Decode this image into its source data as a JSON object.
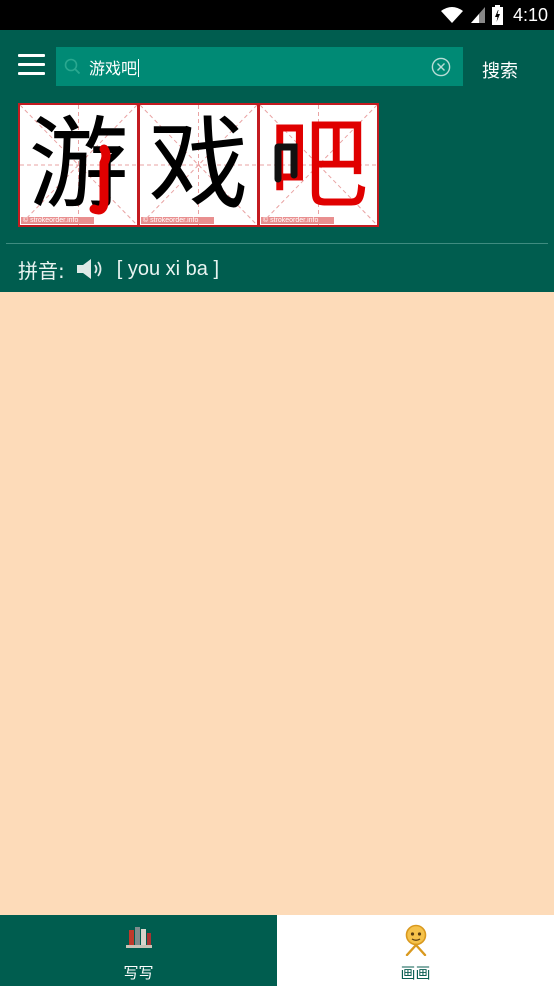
{
  "status_bar": {
    "time": "4:10"
  },
  "search": {
    "query": "游戏吧",
    "button_label": "搜索"
  },
  "characters": [
    {
      "char": "游",
      "watermark": "© strokeorder.info"
    },
    {
      "char": "戏",
      "watermark": "© strokeorder.info"
    },
    {
      "char": "吧",
      "watermark": "© strokeorder.info"
    }
  ],
  "pinyin": {
    "label": "拼音:",
    "value": "[ you xi ba ]"
  },
  "bottom_nav": {
    "tabs": [
      {
        "label": "写写",
        "icon": "books-icon"
      },
      {
        "label": "画画",
        "icon": "smiley-figure-icon"
      }
    ]
  },
  "colors": {
    "header": "#005d4f",
    "search_box": "#008a75",
    "content_bg": "#fddbb9",
    "card_border": "#c31b20",
    "stroke_highlight": "#e00000",
    "active_tab_text": "#0a5e52"
  }
}
